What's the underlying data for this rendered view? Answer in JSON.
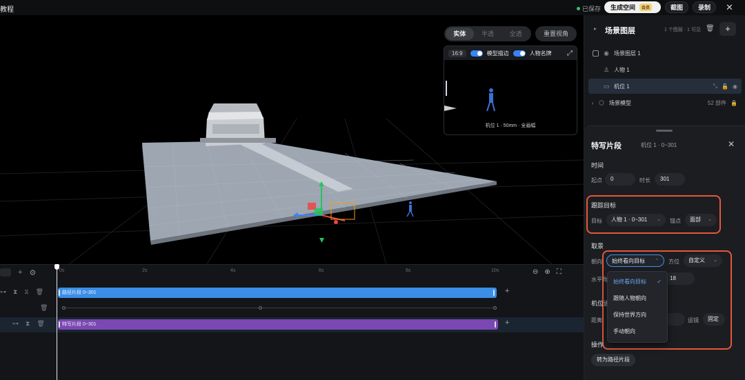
{
  "topbar": {
    "title_fragment": "教程",
    "saved_label": "已保存",
    "generate_label": "生成空间",
    "generate_badge": "会员",
    "snapshot_label": "截图",
    "record_label": "录制",
    "close_glyph": "✕"
  },
  "viewport": {
    "view_modes": [
      "实体",
      "半透",
      "全透"
    ],
    "active_view_mode": "实体",
    "reset_view_label": "重置视角",
    "preview": {
      "ratio": "16:9",
      "outline_label": "模型描边",
      "nameplate_label": "人物名牌",
      "outline_on": true,
      "nameplate_on": true,
      "caption": "机位 1 · 50mm · 全画幅"
    }
  },
  "timeline": {
    "ticks": [
      "0s",
      "2s",
      "4s",
      "6s",
      "8s",
      "10s"
    ],
    "tracks": [
      {
        "label": "路径片段 0~301",
        "color": "#3b8ee8",
        "kind": "segment"
      },
      {
        "label": "",
        "kind": "keyframes"
      },
      {
        "label": "特写片段 0~301",
        "color": "#7a47b3",
        "kind": "segment"
      }
    ],
    "add_glyph": "+"
  },
  "layers": {
    "title": "场景图层",
    "meta": "1 个图层 · 1 可见",
    "items": [
      {
        "label": "场景图层 1",
        "icon": "eye-icon"
      },
      {
        "label": "人物 1",
        "icon": "person-icon"
      },
      {
        "label": "机位 1",
        "icon": "camera-icon",
        "selected": true
      },
      {
        "label": "场景模型",
        "icon": "cube-icon",
        "meta": "52 部件"
      }
    ]
  },
  "segment_editor": {
    "title": "特写片段",
    "subtitle": "机位 1 · 0~301",
    "time_section": "时间",
    "start_label": "起点",
    "start_value": "0",
    "duration_label": "时长",
    "duration_value": "301",
    "tracking_section": "跟踪目标",
    "target_label": "目标",
    "target_value": "人物 1 · 0~301",
    "anchor_label": "锚点",
    "anchor_value": "面部",
    "framing_section": "取景",
    "orientation_label": "朝向",
    "orientation_value": "始终看向目标",
    "azimuth_label": "方位",
    "azimuth_value": "自定义",
    "horizontal_label": "水平角",
    "horizontal_value": "18",
    "position_section": "机位设置",
    "distance_label": "距离",
    "lens_label": "运镜",
    "lens_value": "固定",
    "operation_section": "操作",
    "convert_label": "转为路径片段",
    "orientation_options": [
      "始终看向目标",
      "跟随人物朝向",
      "保持世界方向",
      "手动朝向"
    ],
    "selected_option": "始终看向目标"
  },
  "colors": {
    "accent_blue": "#3b8ee8",
    "segment_purple": "#7a47b3",
    "highlight_red": "#e3583b",
    "saved_green": "#35c46b"
  }
}
